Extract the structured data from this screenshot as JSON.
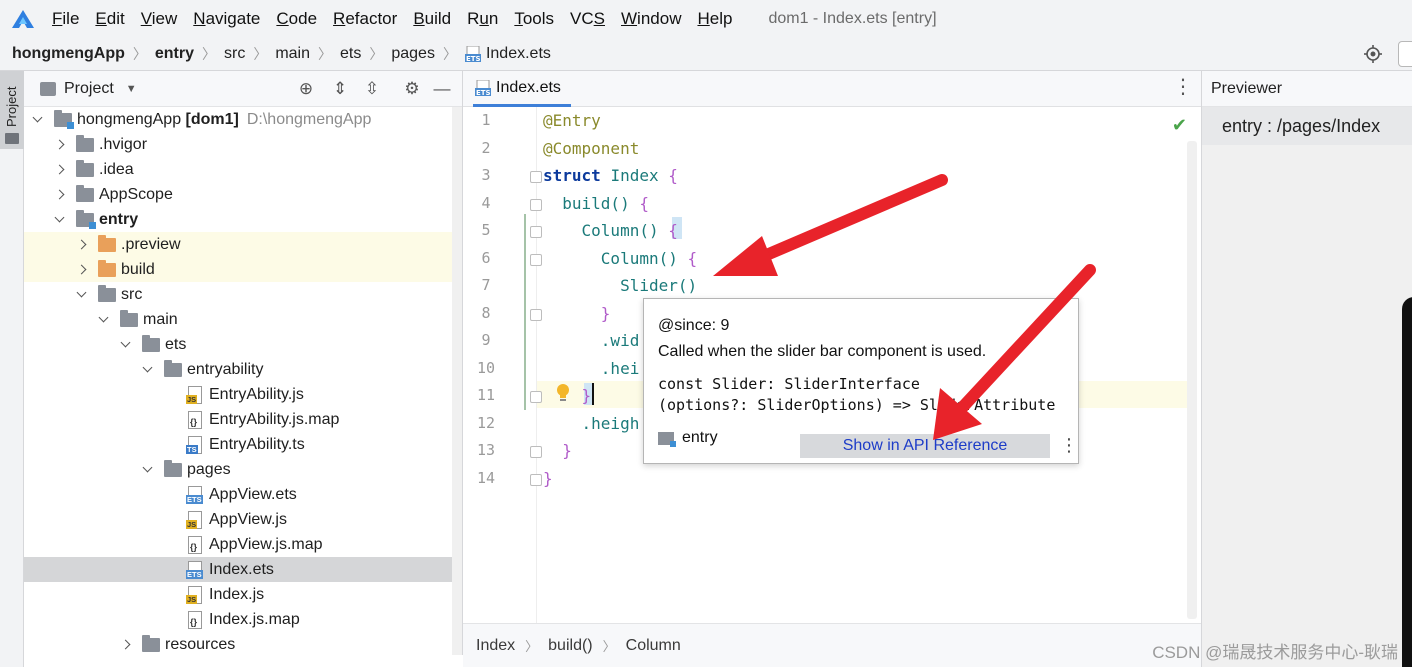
{
  "menubar": {
    "items": [
      {
        "label": "File",
        "mnemonic": "F"
      },
      {
        "label": "Edit",
        "mnemonic": "E"
      },
      {
        "label": "View",
        "mnemonic": "V"
      },
      {
        "label": "Navigate",
        "mnemonic": "N"
      },
      {
        "label": "Code",
        "mnemonic": "C"
      },
      {
        "label": "Refactor",
        "mnemonic": "R"
      },
      {
        "label": "Build",
        "mnemonic": "B"
      },
      {
        "label": "Run",
        "mnemonic": "u"
      },
      {
        "label": "Tools",
        "mnemonic": "T"
      },
      {
        "label": "VCS",
        "mnemonic": "S"
      },
      {
        "label": "Window",
        "mnemonic": "W"
      },
      {
        "label": "Help",
        "mnemonic": "H"
      }
    ],
    "window_title": "dom1 - Index.ets [entry]"
  },
  "breadcrumb": [
    "hongmengApp",
    "entry",
    "src",
    "main",
    "ets",
    "pages",
    "Index.ets"
  ],
  "left_strip": {
    "project_tab": "Project"
  },
  "project_panel": {
    "title": "Project",
    "tree": [
      {
        "indent": 0,
        "expand": "down",
        "icon": "folder-module",
        "label": "hongmengApp [dom1]",
        "bold_part": "[dom1]",
        "path": "D:\\hongmengApp"
      },
      {
        "indent": 1,
        "expand": "right",
        "icon": "folder",
        "label": ".hvigor"
      },
      {
        "indent": 1,
        "expand": "right",
        "icon": "folder",
        "label": ".idea"
      },
      {
        "indent": 1,
        "expand": "right",
        "icon": "folder",
        "label": "AppScope"
      },
      {
        "indent": 1,
        "expand": "down",
        "icon": "folder-module",
        "label": "entry",
        "bold": true
      },
      {
        "indent": 2,
        "expand": "right",
        "icon": "folder-orange",
        "label": ".preview",
        "highlight": true
      },
      {
        "indent": 2,
        "expand": "right",
        "icon": "folder-orange",
        "label": "build",
        "highlight": true
      },
      {
        "indent": 2,
        "expand": "down",
        "icon": "folder",
        "label": "src"
      },
      {
        "indent": 3,
        "expand": "down",
        "icon": "folder",
        "label": "main"
      },
      {
        "indent": 4,
        "expand": "down",
        "icon": "folder",
        "label": "ets"
      },
      {
        "indent": 5,
        "expand": "down",
        "icon": "folder",
        "label": "entryability"
      },
      {
        "indent": 6,
        "expand": "none",
        "icon": "file-js",
        "label": "EntryAbility.js"
      },
      {
        "indent": 6,
        "expand": "none",
        "icon": "file-map",
        "label": "EntryAbility.js.map"
      },
      {
        "indent": 6,
        "expand": "none",
        "icon": "file-ts",
        "label": "EntryAbility.ts"
      },
      {
        "indent": 5,
        "expand": "down",
        "icon": "folder",
        "label": "pages"
      },
      {
        "indent": 6,
        "expand": "none",
        "icon": "file-ets",
        "label": "AppView.ets"
      },
      {
        "indent": 6,
        "expand": "none",
        "icon": "file-js",
        "label": "AppView.js"
      },
      {
        "indent": 6,
        "expand": "none",
        "icon": "file-map",
        "label": "AppView.js.map"
      },
      {
        "indent": 6,
        "expand": "none",
        "icon": "file-ets",
        "label": "Index.ets",
        "selected": true
      },
      {
        "indent": 6,
        "expand": "none",
        "icon": "file-js",
        "label": "Index.js"
      },
      {
        "indent": 6,
        "expand": "none",
        "icon": "file-map",
        "label": "Index.js.map"
      },
      {
        "indent": 4,
        "expand": "right",
        "icon": "folder",
        "label": "resources"
      }
    ]
  },
  "editor": {
    "tab_label": "Index.ets",
    "line_numbers": [
      "1",
      "2",
      "3",
      "4",
      "5",
      "6",
      "7",
      "8",
      "9",
      "10",
      "11",
      "12",
      "13",
      "14"
    ],
    "code_lines": [
      [
        {
          "t": "@Entry",
          "c": "kw-dec"
        }
      ],
      [
        {
          "t": "@Component",
          "c": "kw-dec"
        }
      ],
      [
        {
          "t": "struct ",
          "c": "kw"
        },
        {
          "t": "Index ",
          "c": "cls"
        },
        {
          "t": "{",
          "c": "brace"
        }
      ],
      [
        {
          "t": "  build() ",
          "c": "fn"
        },
        {
          "t": "{",
          "c": "brace"
        }
      ],
      [
        {
          "t": "    Column() ",
          "c": "fn"
        },
        {
          "t": "{",
          "c": "brace"
        }
      ],
      [
        {
          "t": "      Column() ",
          "c": "fn"
        },
        {
          "t": "{",
          "c": "brace"
        }
      ],
      [
        {
          "t": "        Slider()",
          "c": "fn"
        }
      ],
      [
        {
          "t": "      }",
          "c": "brace"
        }
      ],
      [
        {
          "t": "      .wid",
          "c": "fn"
        }
      ],
      [
        {
          "t": "      .hei",
          "c": "fn"
        }
      ],
      [
        {
          "t": "    }",
          "c": "brace"
        }
      ],
      [
        {
          "t": "    .heigh",
          "c": "fn"
        }
      ],
      [
        {
          "t": "  }",
          "c": "brace"
        }
      ],
      [
        {
          "t": "}",
          "c": "brace"
        }
      ]
    ],
    "status_crumbs": [
      "Index",
      "build()",
      "Column"
    ]
  },
  "popup": {
    "since": "@since: 9",
    "description": "Called when the slider bar component is used.",
    "signature_line1": "const Slider: SliderInterface",
    "signature_line2": "(options?: SliderOptions) => SliderAttribute",
    "module": "entry",
    "api_button": "Show in API Reference"
  },
  "previewer": {
    "title": "Previewer",
    "path": "entry : /pages/Index"
  },
  "watermark": "CSDN @瑞晟技术服务中心-耿瑞",
  "colors": {
    "accent": "#3d7fd8",
    "arrow": "#e8232a",
    "link": "#1d3cc8"
  }
}
